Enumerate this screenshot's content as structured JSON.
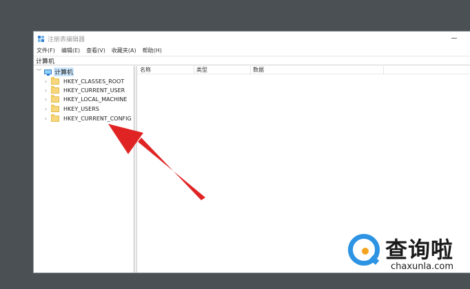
{
  "window": {
    "title": "注册表编辑器",
    "menu": [
      "文件(F)",
      "编辑(E)",
      "查看(V)",
      "收藏夹(A)",
      "帮助(H)"
    ],
    "address": "计算机"
  },
  "tree": {
    "root": "计算机",
    "items": [
      "HKEY_CLASSES_ROOT",
      "HKEY_CURRENT_USER",
      "HKEY_LOCAL_MACHINE",
      "HKEY_USERS",
      "HKEY_CURRENT_CONFIG"
    ]
  },
  "list": {
    "columns": [
      "名称",
      "类型",
      "数据"
    ]
  },
  "watermark": {
    "cn": "查询啦",
    "en": "chaxunla.com"
  },
  "colors": {
    "arrow": "#e02424",
    "selection": "#cce8ff",
    "desktop": "#4b5054"
  },
  "icons": {
    "app": "regedit-icon",
    "root": "computer-icon",
    "item": "folder-icon",
    "collapsed": "chevron-right-icon",
    "expanded": "chevron-down-icon"
  }
}
